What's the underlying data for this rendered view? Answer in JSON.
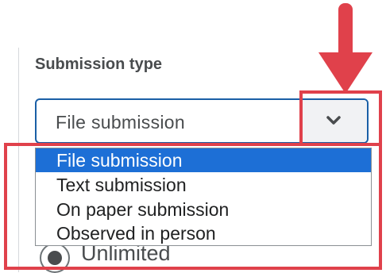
{
  "field": {
    "label": "Submission type",
    "selected_value": "File submission",
    "toggle_icon": "chevron-down-icon"
  },
  "dropdown": {
    "options": [
      {
        "label": "File submission",
        "selected": true
      },
      {
        "label": "Text submission",
        "selected": false
      },
      {
        "label": "On paper submission",
        "selected": false
      },
      {
        "label": "Observed in person",
        "selected": false
      }
    ]
  },
  "behind": {
    "radio_label": "Unlimited"
  },
  "colors": {
    "accent": "#1d6fd6",
    "annotation": "#e0414b"
  }
}
